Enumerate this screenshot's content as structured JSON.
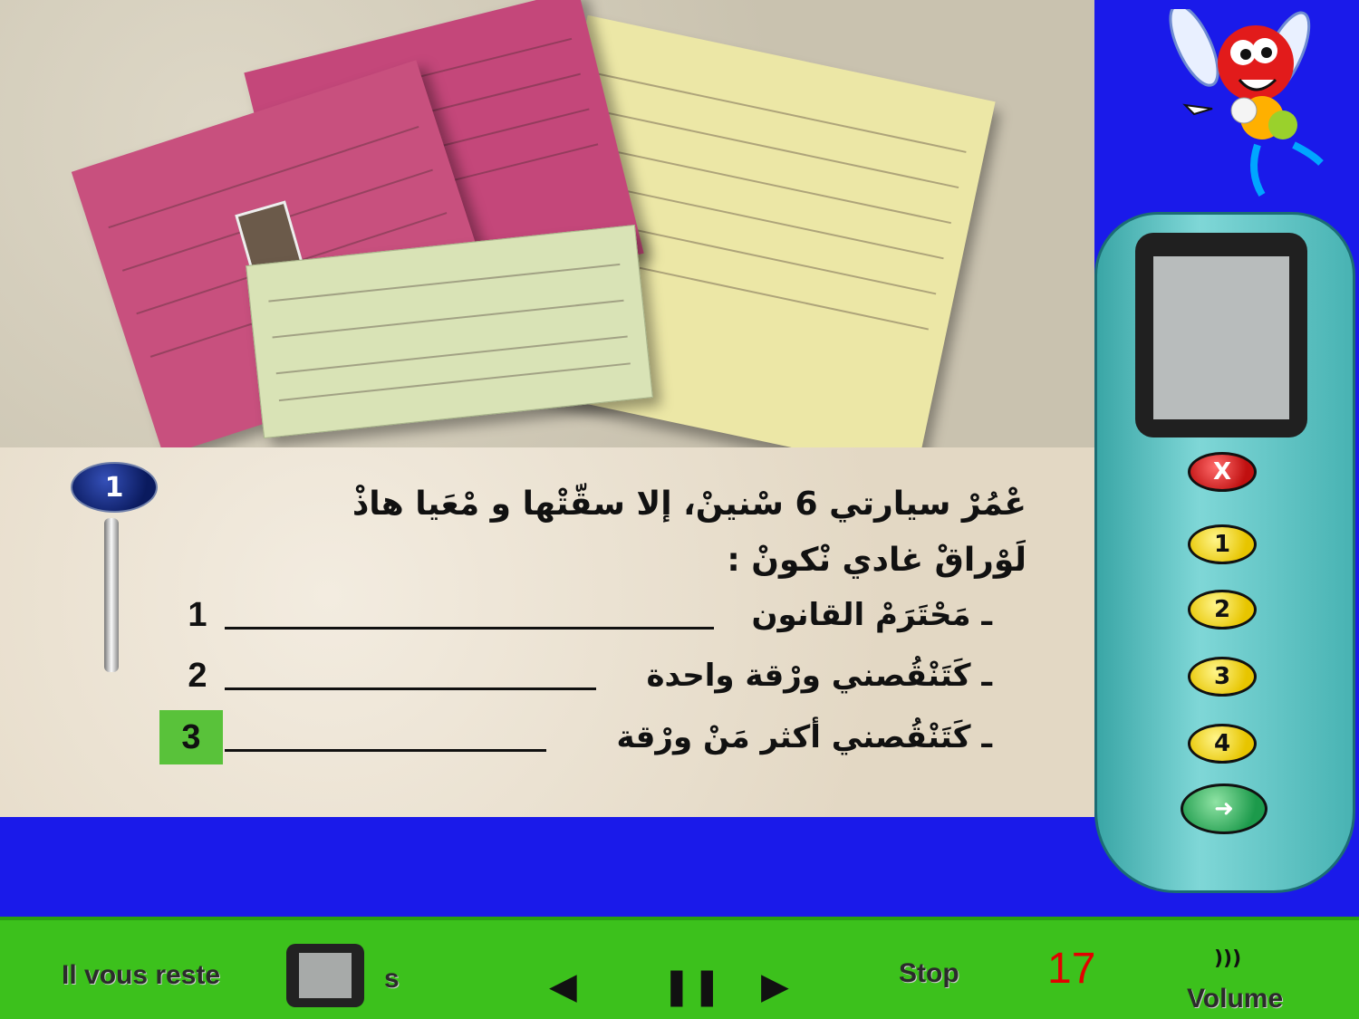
{
  "question": {
    "number": "1",
    "text_line1": "عْمُرْ سيارتي 6 سْنينْ، إلا سقّتْها و مْعَيا هاذْ",
    "text_line2": "لَوْراقْ غادي نْكونْ :",
    "answers": [
      {
        "num": "1",
        "label": "ـ مَحْتَرَمْ القانون",
        "selected": false
      },
      {
        "num": "2",
        "label": "ـ كَتَنْقُصني ورْقة واحدة",
        "selected": false
      },
      {
        "num": "3",
        "label": "ـ كَتَنْقُصني أكثر مَنْ ورْقة",
        "selected": true
      }
    ]
  },
  "remote": {
    "cancel_label": "X",
    "buttons": [
      "1",
      "2",
      "3",
      "4"
    ],
    "next_label": "➜"
  },
  "bottom_bar": {
    "time_label": "Il vous reste",
    "unit_label": "s",
    "prev_label": "◀",
    "pause_label": "❚❚",
    "next_label": "▶",
    "stop_label": "Stop",
    "score": "17",
    "volume_icon": ")))",
    "volume_label": "Volume"
  },
  "colors": {
    "background_blue": "#1a1aea",
    "bottom_green": "#3cc11c",
    "selected_green": "#59c23a",
    "score_red": "#e30000"
  },
  "icons": {
    "mascot": "cartoon-fly-mascot-icon",
    "next": "arrow-right-icon",
    "cancel": "close-icon",
    "volume": "speaker-waves-icon"
  }
}
